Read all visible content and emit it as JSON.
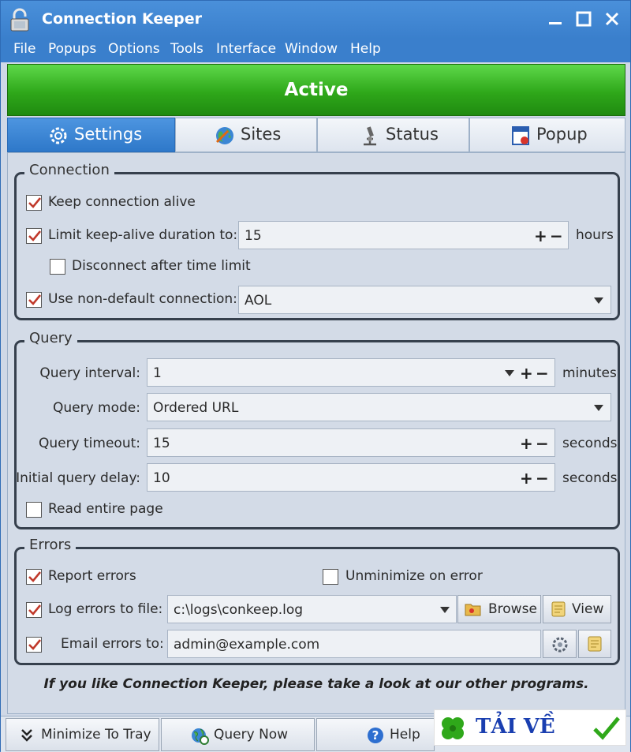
{
  "window": {
    "title": "Connection Keeper",
    "controls": [
      "minimize-icon",
      "maximize-icon",
      "close-icon"
    ]
  },
  "menu": [
    "File",
    "Popups",
    "Options",
    "Tools",
    "Interface",
    "Window",
    "Help"
  ],
  "status": {
    "text": "Active",
    "color": "#2fa81a"
  },
  "tabs": [
    {
      "label": "Settings",
      "icon": "gear-icon",
      "active": true
    },
    {
      "label": "Sites",
      "icon": "globe-icon",
      "active": false
    },
    {
      "label": "Status",
      "icon": "microscope-icon",
      "active": false
    },
    {
      "label": "Popup",
      "icon": "popup-window-icon",
      "active": false
    }
  ],
  "connection": {
    "title": "Connection",
    "keep_alive": {
      "label": "Keep connection alive",
      "checked": true
    },
    "limit_duration": {
      "label": "Limit keep-alive duration to:",
      "checked": true,
      "value": "15",
      "unit": "hours"
    },
    "disconnect": {
      "label": "Disconnect after time limit",
      "checked": false
    },
    "non_default": {
      "label": "Use non-default connection:",
      "checked": true,
      "value": "AOL"
    }
  },
  "query": {
    "title": "Query",
    "interval": {
      "label": "Query interval:",
      "value": "1",
      "unit": "minutes"
    },
    "mode": {
      "label": "Query mode:",
      "value": "Ordered URL"
    },
    "timeout": {
      "label": "Query timeout:",
      "value": "15",
      "unit": "seconds"
    },
    "initial_delay": {
      "label": "Initial query delay:",
      "value": "10",
      "unit": "seconds"
    },
    "read_entire": {
      "label": "Read entire page",
      "checked": false
    }
  },
  "errors": {
    "title": "Errors",
    "report": {
      "label": "Report errors",
      "checked": true
    },
    "unminimize": {
      "label": "Unminimize on error",
      "checked": false
    },
    "log_file": {
      "label": "Log errors to file:",
      "checked": true,
      "value": "c:\\logs\\conkeep.log",
      "browse_label": "Browse",
      "view_label": "View"
    },
    "email": {
      "label": "Email errors to:",
      "checked": true,
      "value": "admin@example.com"
    }
  },
  "footer_note": "If you like Connection Keeper, please take a look at our other programs.",
  "bottom": {
    "minimize": "Minimize To Tray",
    "query_now": "Query Now",
    "help": "Help"
  },
  "watermark": {
    "text": "TẢI VỀ"
  },
  "symbols": {
    "plus": "+",
    "minus": "−"
  },
  "colors": {
    "accent": "#3a7fcc",
    "check": "#c0392b",
    "tab_active": "#2e78c9"
  }
}
